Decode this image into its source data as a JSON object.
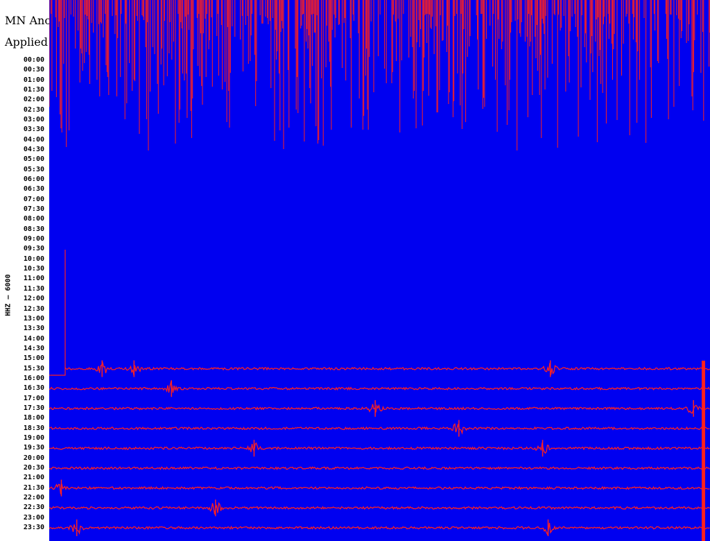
{
  "header": {
    "title": "MN Ano",
    "subtitle": "Applied"
  },
  "colors": {
    "background": "#0000f0",
    "trace": "#ff2020"
  },
  "chart_data": {
    "type": "line",
    "title": "MN Ano",
    "subtitle": "Applied",
    "ylabel": "HHZ – 6000",
    "row_duration_minutes": 60,
    "tick_labels": [
      "00:00",
      "00:30",
      "01:00",
      "01:30",
      "02:00",
      "02:30",
      "03:00",
      "03:30",
      "04:00",
      "04:30",
      "05:00",
      "05:30",
      "06:00",
      "06:30",
      "07:00",
      "07:30",
      "08:00",
      "08:30",
      "09:00",
      "09:30",
      "10:00",
      "10:30",
      "11:00",
      "11:30",
      "12:00",
      "12:30",
      "13:00",
      "13:30",
      "14:00",
      "14:30",
      "15:00",
      "15:30",
      "16:00",
      "16:30",
      "17:00",
      "17:30",
      "18:00",
      "18:30",
      "19:00",
      "19:30",
      "20:00",
      "20:30",
      "21:00",
      "21:30",
      "22:00",
      "22:30",
      "23:00",
      "23:30"
    ],
    "saturated_until": "15:30",
    "traces": [
      {
        "label": "15:30",
        "events_minutes": [
          4.8,
          7.7,
          45.5
        ]
      },
      {
        "label": "16:30",
        "events_minutes": [
          11.1
        ]
      },
      {
        "label": "17:30",
        "events_minutes": [
          29.6,
          58.5
        ]
      },
      {
        "label": "18:30",
        "events_minutes": [
          37.2
        ]
      },
      {
        "label": "19:30",
        "events_minutes": [
          18.6,
          44.8
        ]
      },
      {
        "label": "20:30",
        "events_minutes": []
      },
      {
        "label": "21:30",
        "events_minutes": [
          1.1
        ]
      },
      {
        "label": "22:30",
        "events_minutes": [
          15.1
        ]
      },
      {
        "label": "23:30",
        "events_minutes": [
          2.5,
          45.3
        ]
      }
    ]
  }
}
